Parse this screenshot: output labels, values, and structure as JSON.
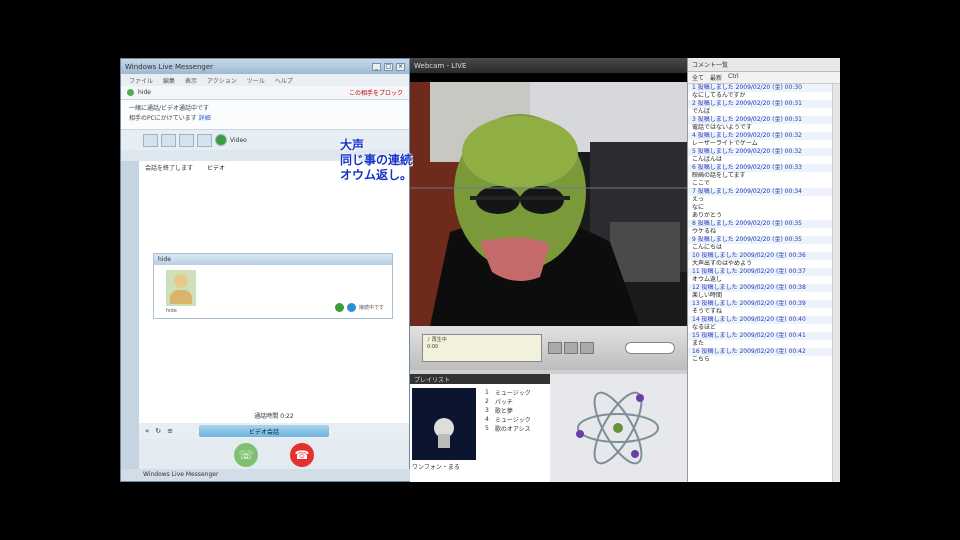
{
  "messenger": {
    "title": "Windows Live Messenger",
    "menu": [
      "ファイル",
      "編集",
      "表示",
      "アクション",
      "ツール",
      "ヘルプ"
    ],
    "contact_name": "hide",
    "contact_right": "この相手をブロック",
    "info_line1": "一緒に通話/ビデオ通話中です",
    "info_line2": "相手のPCにかけています",
    "info_link": "詳細",
    "tab_label": "Video",
    "actions": [
      "会話を終了します",
      "ビデオ"
    ],
    "card_header": "hide",
    "avatar_name": "hide",
    "card_status": "接続中です",
    "status_line": "通話時間 0:22",
    "call_control": "ビデオ会話",
    "bottom": "Windows Live Messenger"
  },
  "caption": {
    "line1": "大声",
    "line2": "同じ事の連続",
    "line3": "オウム返し。"
  },
  "webcam": {
    "title": "Webcam - LIVE"
  },
  "player": {
    "lcd_line1": "♪ 再生中",
    "lcd_line2": "0:00",
    "list_header": "プレイリスト",
    "art_caption": "ワンフォン・まる",
    "tracks": [
      {
        "n": "1",
        "name": "ミュージック"
      },
      {
        "n": "2",
        "name": "パッチ"
      },
      {
        "n": "3",
        "name": "歌と夢"
      },
      {
        "n": "4",
        "name": "ミュージック"
      },
      {
        "n": "5",
        "name": "歌のオアシス"
      }
    ]
  },
  "chatlog": {
    "header": "コメント一覧",
    "tabs": [
      "全て",
      "最新",
      "Ctrl"
    ],
    "lines": [
      {
        "t": "1 投稿しました 2009/02/20 (金) 00:30",
        "meta": true
      },
      {
        "t": "なにしてるんですか",
        "meta": false
      },
      {
        "t": "2 投稿しました 2009/02/20 (金) 00:31",
        "meta": true
      },
      {
        "t": "でんぱ",
        "meta": false
      },
      {
        "t": "3 投稿しました 2009/02/20 (金) 00:31",
        "meta": true
      },
      {
        "t": "電話ではないようです",
        "meta": false
      },
      {
        "t": "4 投稿しました 2009/02/20 (金) 00:32",
        "meta": true
      },
      {
        "t": "レーザーライトでゲーム",
        "meta": false
      },
      {
        "t": "5 投稿しました 2009/02/20 (金) 00:32",
        "meta": true
      },
      {
        "t": "こんばんは",
        "meta": false
      },
      {
        "t": "6 投稿しました 2009/02/20 (金) 00:33",
        "meta": true
      },
      {
        "t": "映画の話をしてます",
        "meta": false
      },
      {
        "t": "ここで",
        "meta": false
      },
      {
        "t": "7 投稿しました 2009/02/20 (金) 00:34",
        "meta": true
      },
      {
        "t": "えっ",
        "meta": false
      },
      {
        "t": "なに",
        "meta": false
      },
      {
        "t": "ありがとう",
        "meta": false
      },
      {
        "t": "8 投稿しました 2009/02/20 (金) 00:35",
        "meta": true
      },
      {
        "t": "ウケるね",
        "meta": false
      },
      {
        "t": "9 投稿しました 2009/02/20 (金) 00:35",
        "meta": true
      },
      {
        "t": "こんにちは",
        "meta": false
      },
      {
        "t": "10 投稿しました 2009/02/20 (金) 00:36",
        "meta": true
      },
      {
        "t": "大声出すのはやめよう",
        "meta": false
      },
      {
        "t": "11 投稿しました 2009/02/20 (金) 00:37",
        "meta": true
      },
      {
        "t": "オウム返し",
        "meta": false
      },
      {
        "t": "12 投稿しました 2009/02/20 (金) 00:38",
        "meta": true
      },
      {
        "t": "楽しい時間",
        "meta": false
      },
      {
        "t": "13 投稿しました 2009/02/20 (金) 00:39",
        "meta": true
      },
      {
        "t": "そうですね",
        "meta": false
      },
      {
        "t": "14 投稿しました 2009/02/20 (金) 00:40",
        "meta": true
      },
      {
        "t": "なるほど",
        "meta": false
      },
      {
        "t": "15 投稿しました 2009/02/20 (金) 00:41",
        "meta": true
      },
      {
        "t": "また",
        "meta": false
      },
      {
        "t": "16 投稿しました 2009/02/20 (金) 00:42",
        "meta": true
      },
      {
        "t": "こちら",
        "meta": false
      }
    ]
  }
}
